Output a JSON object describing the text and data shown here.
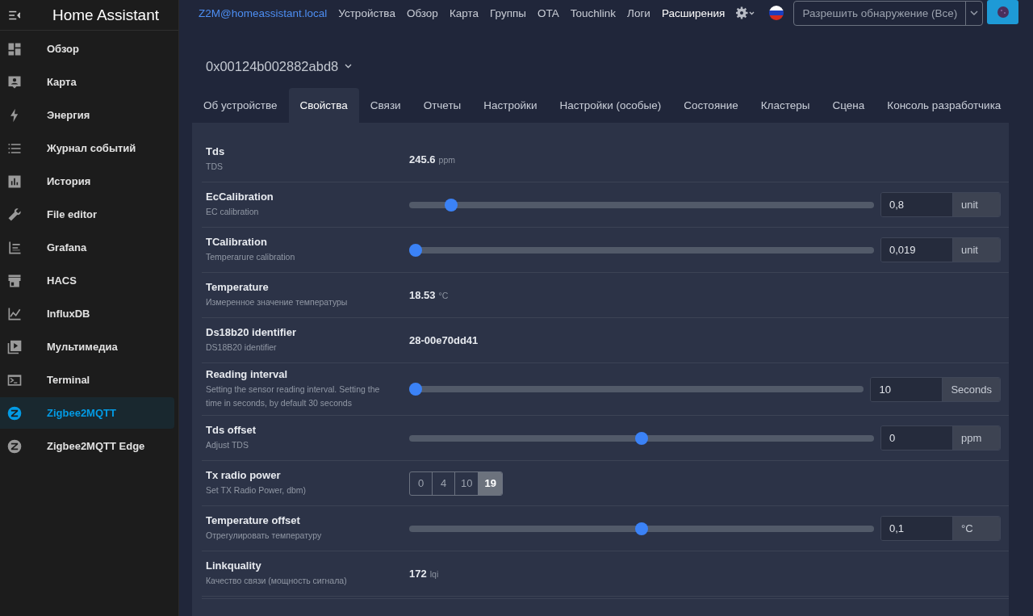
{
  "sidebar": {
    "title": "Home Assistant",
    "items": [
      {
        "label": "Обзор",
        "selected": false
      },
      {
        "label": "Карта",
        "selected": false
      },
      {
        "label": "Энергия",
        "selected": false
      },
      {
        "label": "Журнал событий",
        "selected": false
      },
      {
        "label": "История",
        "selected": false
      },
      {
        "label": "File editor",
        "selected": false
      },
      {
        "label": "Grafana",
        "selected": false
      },
      {
        "label": "HACS",
        "selected": false
      },
      {
        "label": "InfluxDB",
        "selected": false
      },
      {
        "label": "Мультимедиа",
        "selected": false
      },
      {
        "label": "Terminal",
        "selected": false
      },
      {
        "label": "Zigbee2MQTT",
        "selected": true
      },
      {
        "label": "Zigbee2MQTT Edge",
        "selected": false
      }
    ]
  },
  "navbar": {
    "brand": "Z2M@homeassistant.local",
    "links": [
      {
        "label": "Устройства",
        "selected": false
      },
      {
        "label": "Обзор",
        "selected": false
      },
      {
        "label": "Карта",
        "selected": false
      },
      {
        "label": "Группы",
        "selected": false
      },
      {
        "label": "OTA",
        "selected": false
      },
      {
        "label": "Touchlink",
        "selected": false
      },
      {
        "label": "Логи",
        "selected": false
      },
      {
        "label": "Расширения",
        "selected": true
      }
    ],
    "permit_join": "Разрешить обнаружение (Все)"
  },
  "device": {
    "title": "0x00124b002882abd8"
  },
  "tabs": [
    {
      "label": "Об устройстве",
      "selected": false
    },
    {
      "label": "Свойства",
      "selected": true
    },
    {
      "label": "Связи",
      "selected": false
    },
    {
      "label": "Отчеты",
      "selected": false
    },
    {
      "label": "Настройки",
      "selected": false
    },
    {
      "label": "Настройки (особые)",
      "selected": false
    },
    {
      "label": "Состояние",
      "selected": false
    },
    {
      "label": "Кластеры",
      "selected": false
    },
    {
      "label": "Сцена",
      "selected": false
    },
    {
      "label": "Консоль разработчика",
      "selected": false
    }
  ],
  "properties": [
    {
      "kind": "reading",
      "name": "Tds",
      "description": "TDS",
      "value": "245.6",
      "unit": "ppm"
    },
    {
      "kind": "slider",
      "name": "EcCalibration",
      "description": "EC calibration",
      "level": 0.09,
      "value": "0,8",
      "unit": "unit"
    },
    {
      "kind": "slider",
      "name": "TCalibration",
      "description": "Temperarure calibration",
      "level": 0,
      "value": "0,019",
      "unit": "unit"
    },
    {
      "kind": "reading",
      "name": "Temperature",
      "description": "Измеренное значение температуры",
      "value": "18.53",
      "unit": "°C"
    },
    {
      "kind": "text",
      "name": "Ds18b20 identifier",
      "description": "DS18B20 identifier",
      "value": "28-00e70dd41"
    },
    {
      "kind": "slider",
      "name": "Reading interval",
      "description": "Setting the sensor reading interval. Setting the time in seconds, by default 30 seconds",
      "level": 0,
      "value": "10",
      "unit": "Seconds"
    },
    {
      "kind": "slider",
      "name": "Tds offset",
      "description": "Adjust TDS",
      "level": 0.5,
      "value": "0",
      "unit": "ppm"
    },
    {
      "kind": "enum",
      "name": "Tx radio power",
      "description": "Set TX Radio Power, dbm)",
      "options": [
        {
          "label": "0",
          "selected": false
        },
        {
          "label": "4",
          "selected": false
        },
        {
          "label": "10",
          "selected": false
        },
        {
          "label": "19",
          "selected": true
        }
      ]
    },
    {
      "kind": "slider",
      "name": "Temperature offset",
      "description": "Отрегулировать температуру",
      "level": 0.5,
      "value": "0,1",
      "unit": "°C"
    },
    {
      "kind": "reading",
      "name": "Linkquality",
      "description": "Качество связи (мощность сигнала)",
      "value": "172",
      "unit": "lqi"
    }
  ]
}
